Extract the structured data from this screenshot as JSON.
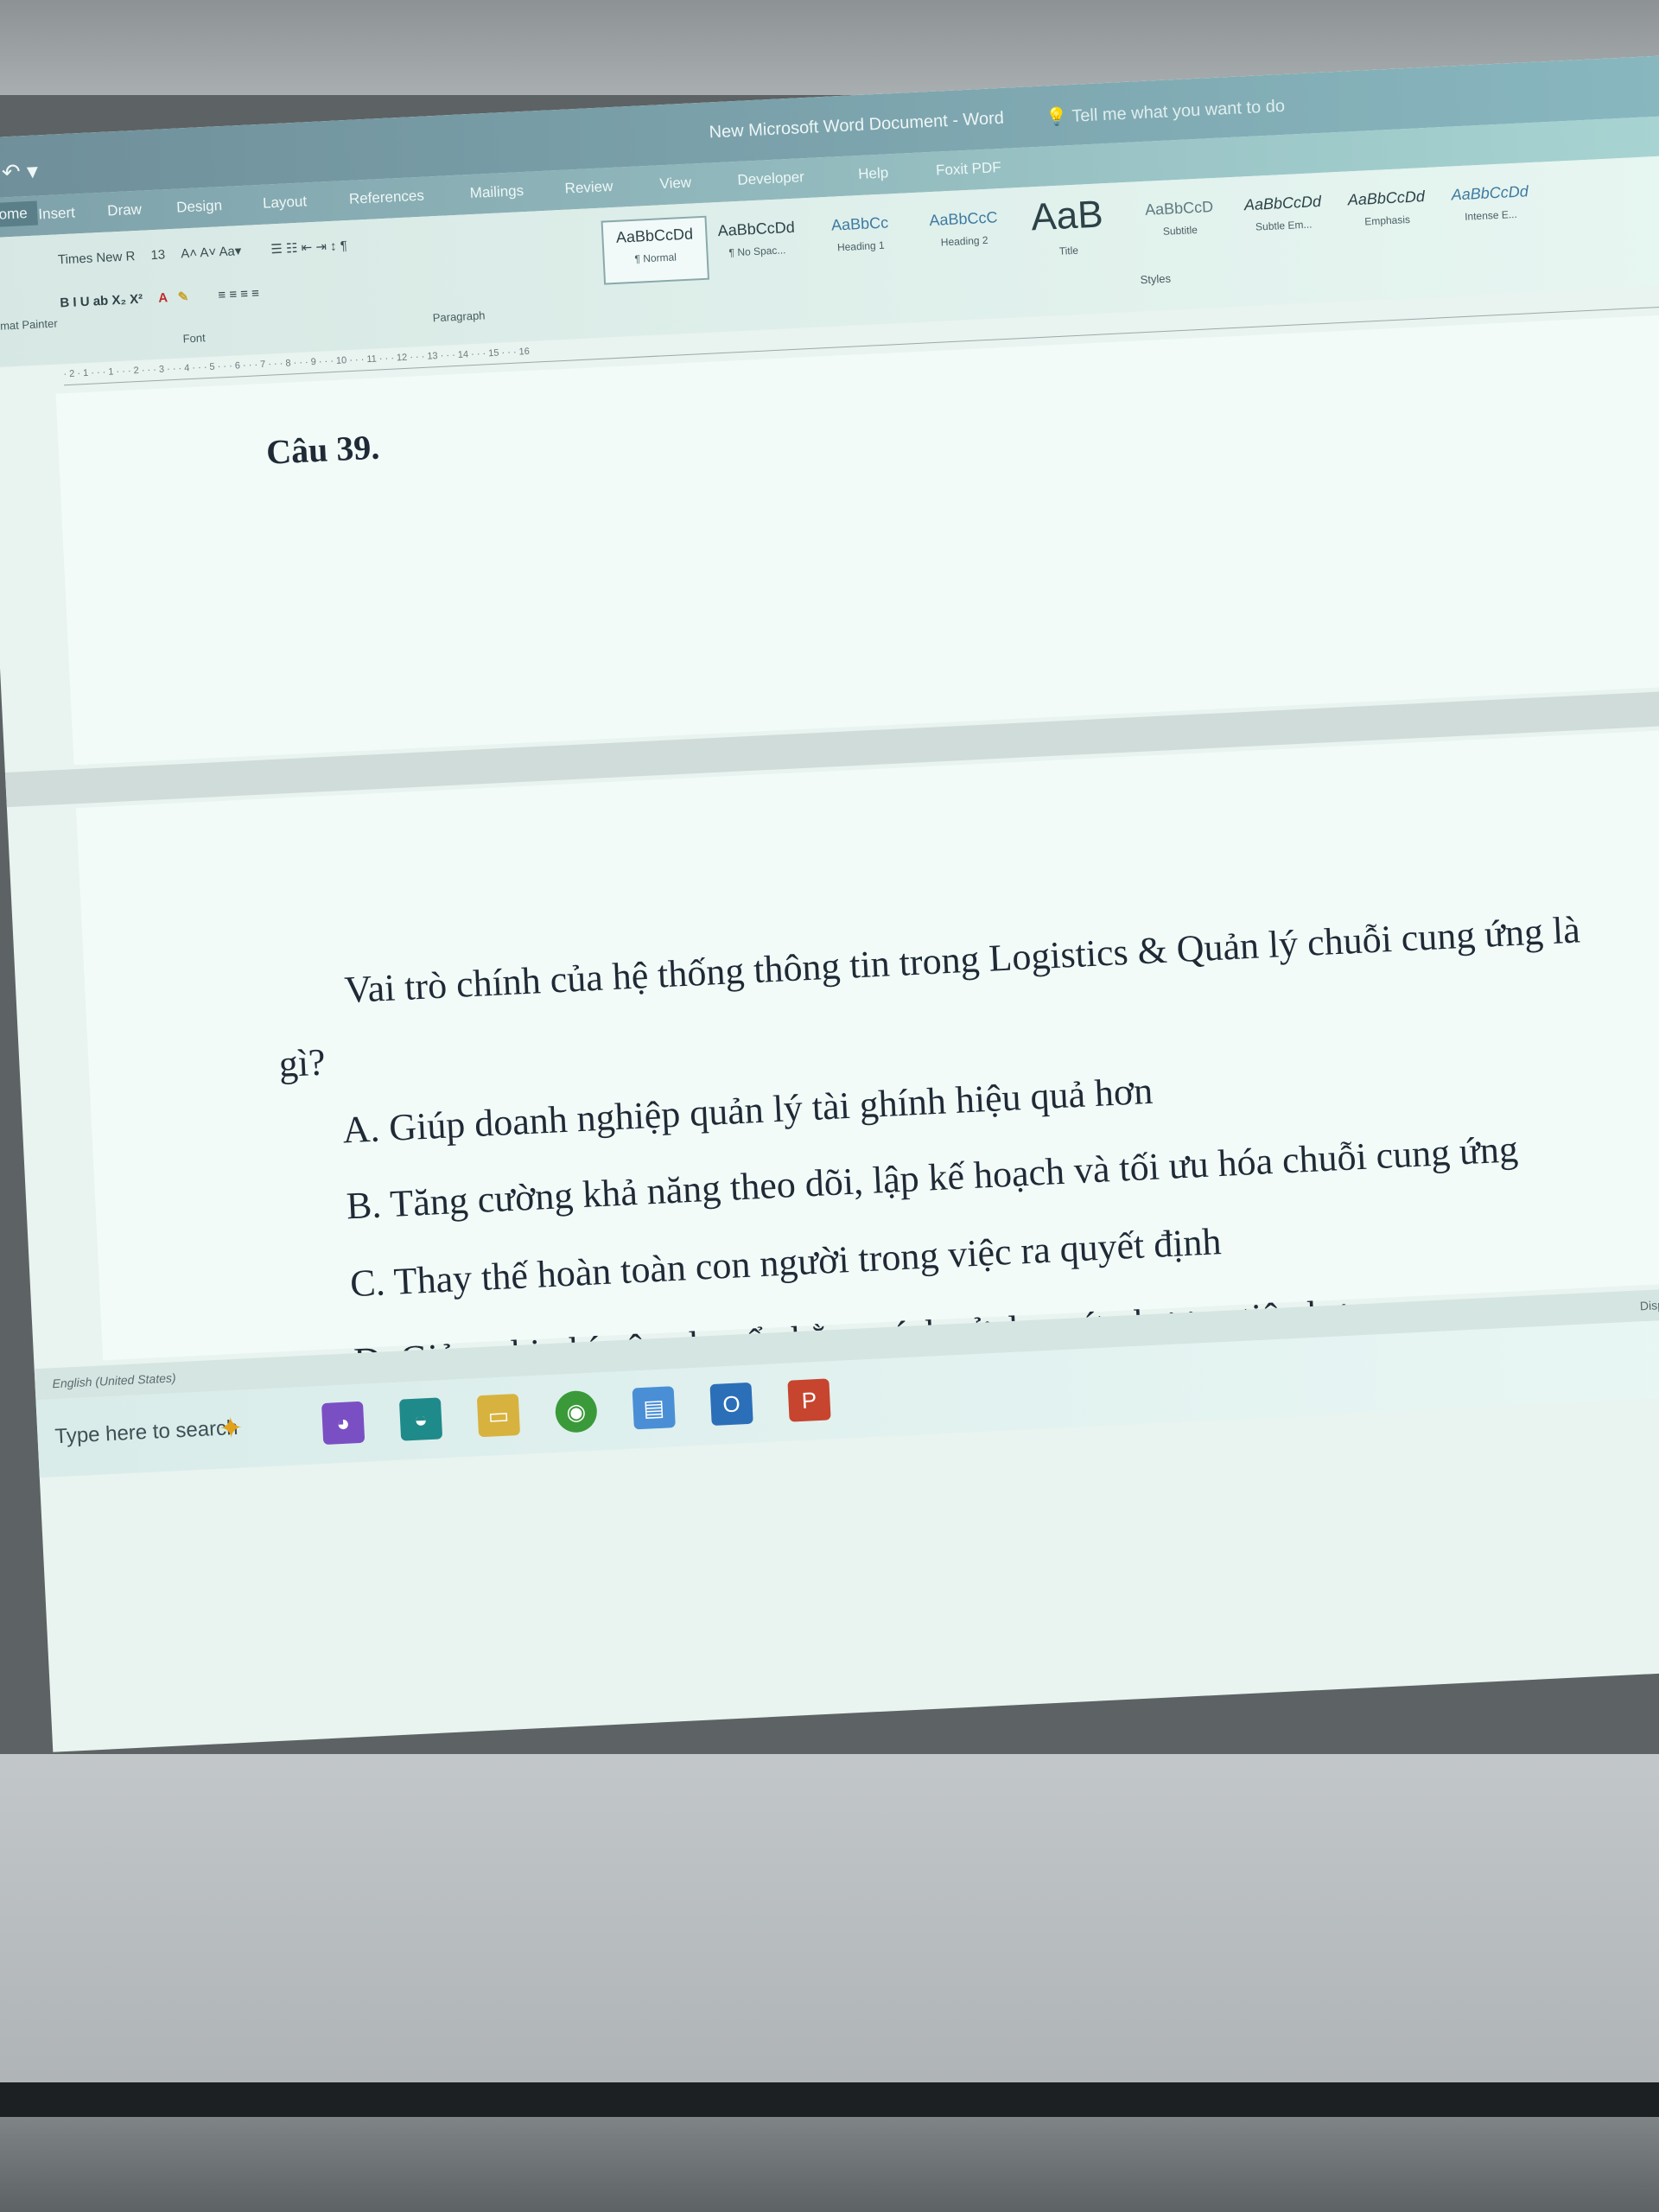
{
  "window": {
    "title": "New Microsoft Word Document - Word",
    "tell_me": "Tell me what you want to do",
    "undo_symbol": "↶ ▾"
  },
  "tabs": [
    "Home",
    "Insert",
    "Draw",
    "Design",
    "Layout",
    "References",
    "Mailings",
    "Review",
    "View",
    "Developer",
    "Help",
    "Foxit PDF"
  ],
  "ribbon": {
    "font_name": "Times New R",
    "font_size": "13",
    "format_buttons": "B  I  U  ab  X₂  X²",
    "group_font": "Font",
    "group_paragraph": "Paragraph",
    "group_styles": "Styles",
    "painter": "Format Painter",
    "styles": [
      {
        "sample": "AaBbCcDd",
        "name": "¶ Normal"
      },
      {
        "sample": "AaBbCcDd",
        "name": "¶ No Spac..."
      },
      {
        "sample": "AaBbCc",
        "name": "Heading 1"
      },
      {
        "sample": "AaBbCcC",
        "name": "Heading 2"
      },
      {
        "sample": "AaB",
        "name": "Title"
      },
      {
        "sample": "AaBbCcD",
        "name": "Subtitle"
      },
      {
        "sample": "AaBbCcDd",
        "name": "Subtle Em..."
      },
      {
        "sample": "AaBbCcDd",
        "name": "Emphasis"
      },
      {
        "sample": "AaBbCcDd",
        "name": "Intense E..."
      }
    ]
  },
  "ruler_marks": "· 2 · 1 · · · 1 · · · 2 · · · 3 · · · 4 · · · 5 · · · 6 · · · 7 · · · 8 · · · 9 · · · 10 · · · 11 · · · 12 · · · 13 · · · 14 · · · 15 · · · 16",
  "document": {
    "question_title": "Câu 39.",
    "stem_line1": "Vai trò chính của hệ thống thông tin trong Logistics & Quản lý chuỗi cung ứng là",
    "stem_line2": "gì?",
    "options": [
      "A. Giúp doanh nghiệp quản lý tài ghính hiệu quả hơn",
      "B. Tăng cường khả năng theo dõi, lập kế hoạch và tối ưu hóa chuỗi cung ứng",
      "C. Thay thế hoàn toàn con người trong việc ra quyết định",
      "D. Giảm chi phí vận chuyển bằng cách sử dụng ít phương tiện hơn"
    ]
  },
  "status": {
    "language": "English (United States)",
    "display": "Display Settings"
  },
  "taskbar": {
    "search": "Type here to search",
    "tray": "^  🔊"
  },
  "colors": {
    "title_bar": "#7ea1aa",
    "page": "#f2fbf8",
    "text": "#1f2a36"
  }
}
